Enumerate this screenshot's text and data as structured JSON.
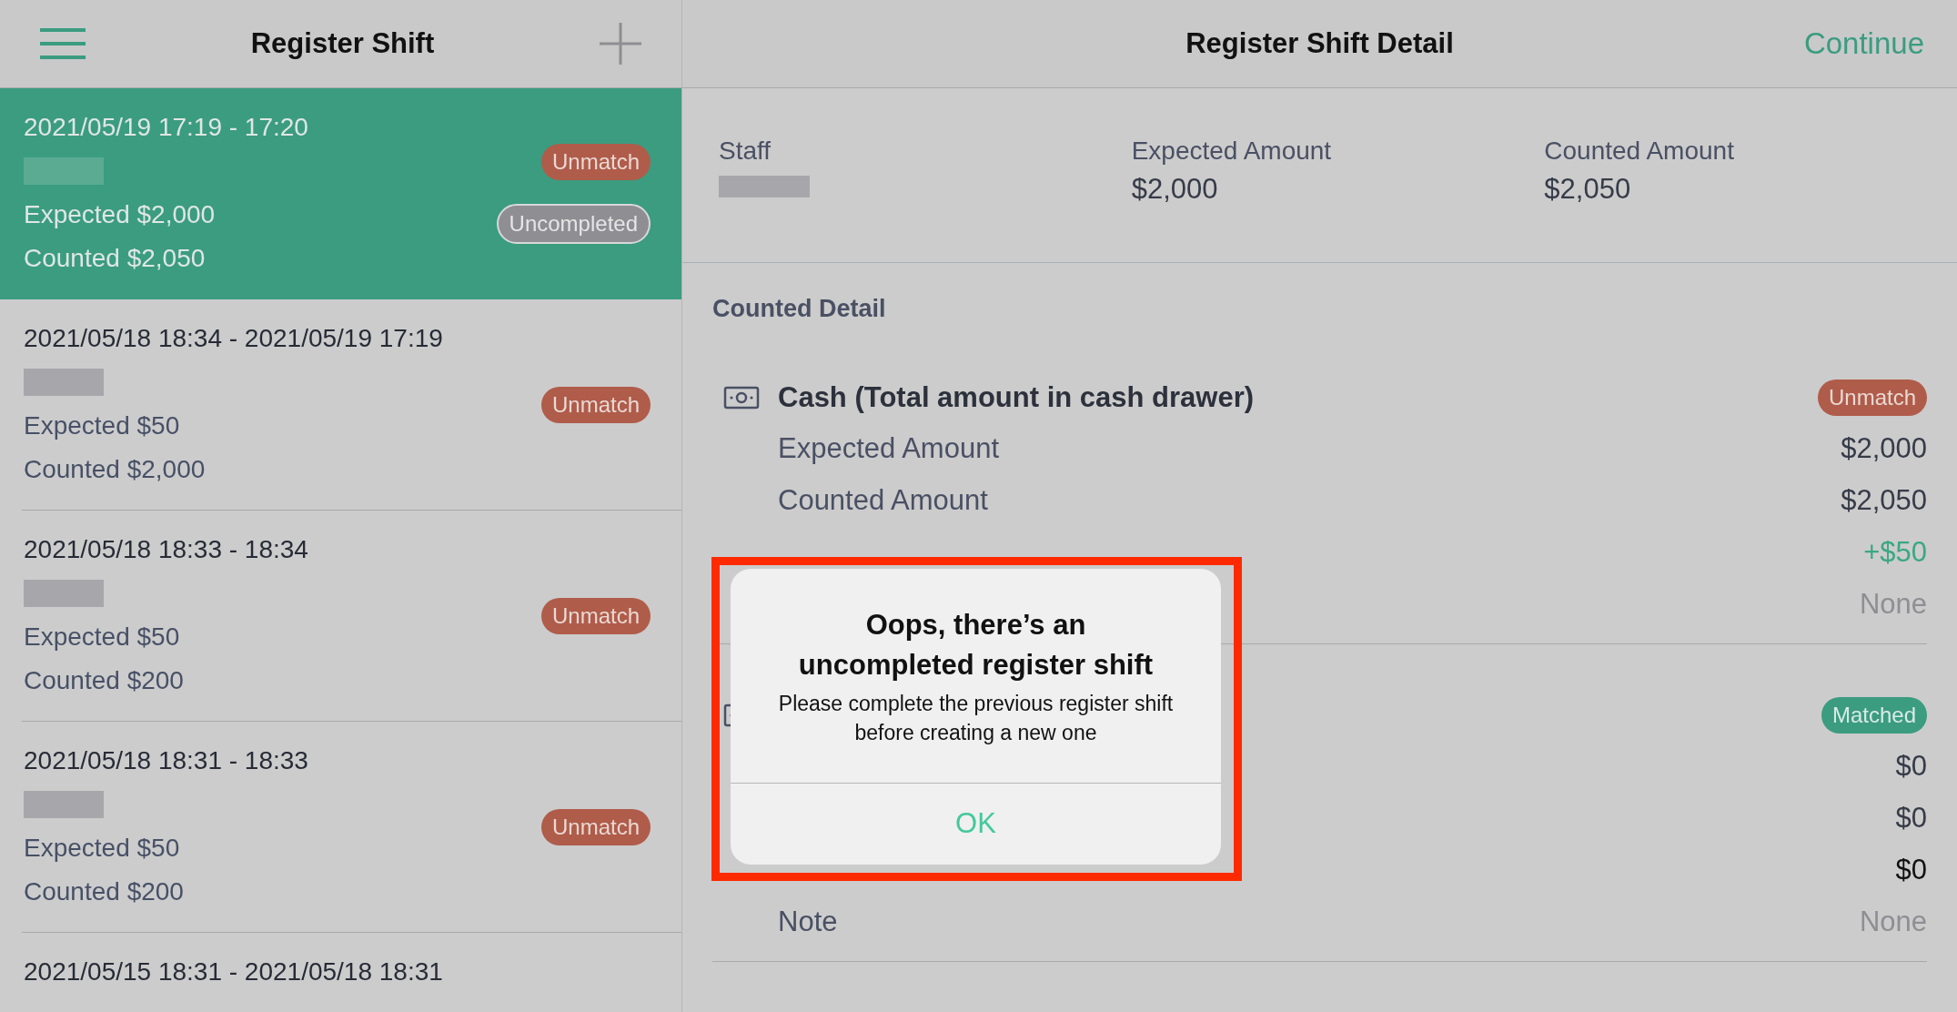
{
  "sidebar": {
    "title": "Register Shift",
    "shifts": [
      {
        "period": "2021/05/19 17:19 - 17:20",
        "name_redacted": true,
        "expected": "Expected $2,000",
        "counted": "Counted $2,050",
        "selected": true,
        "badges": [
          {
            "label": "Unmatch",
            "kind": "unmatch"
          },
          {
            "label": "Uncompleted",
            "kind": "uncompleted"
          }
        ]
      },
      {
        "period": "2021/05/18 18:34 - 2021/05/19 17:19",
        "name_redacted": true,
        "expected": "Expected $50",
        "counted": "Counted $2,000",
        "selected": false,
        "badges": [
          {
            "label": "Unmatch",
            "kind": "unmatch"
          }
        ]
      },
      {
        "period": "2021/05/18 18:33 - 18:34",
        "name_redacted": true,
        "expected": "Expected $50",
        "counted": "Counted $200",
        "selected": false,
        "badges": [
          {
            "label": "Unmatch",
            "kind": "unmatch"
          }
        ]
      },
      {
        "period": "2021/05/18 18:31 - 18:33",
        "name_redacted": true,
        "expected": "Expected $50",
        "counted": "Counted $200",
        "selected": false,
        "badges": [
          {
            "label": "Unmatch",
            "kind": "unmatch"
          }
        ]
      },
      {
        "period": "2021/05/15 18:31 - 2021/05/18 18:31",
        "selected": false
      }
    ]
  },
  "detail": {
    "title": "Register Shift Detail",
    "action": "Continue",
    "summary": [
      {
        "label": "Staff",
        "redacted": true
      },
      {
        "label": "Expected Amount",
        "value": "$2,000"
      },
      {
        "label": "Counted Amount",
        "value": "$2,050"
      }
    ],
    "section_title": "Counted Detail",
    "groups": [
      {
        "title": "Cash (Total amount in cash drawer)",
        "status": {
          "label": "Unmatch",
          "kind": "unmatch"
        },
        "rows": [
          {
            "label": "Expected Amount",
            "value": "$2,000",
            "color": "#363b48"
          },
          {
            "label": "Counted Amount",
            "value": "$2,050",
            "color": "#363b48"
          },
          {
            "value": "+$50",
            "color": "#3ba882"
          },
          {
            "value": "None",
            "color": "#8e8e93"
          }
        ]
      },
      {
        "status": {
          "label": "Matched",
          "kind": "matched"
        },
        "rows": [
          {
            "value": "$0",
            "color": "#363b48"
          },
          {
            "value": "$0",
            "color": "#363b48"
          },
          {
            "value": "$0",
            "color": "#111111"
          },
          {
            "label": "Note",
            "value": "None",
            "color": "#8e8e93"
          }
        ]
      }
    ]
  },
  "alert": {
    "title": "Oops, there’s an uncompleted register shift",
    "message": "Please complete the previous register shift before creating a new one",
    "button": "OK"
  }
}
